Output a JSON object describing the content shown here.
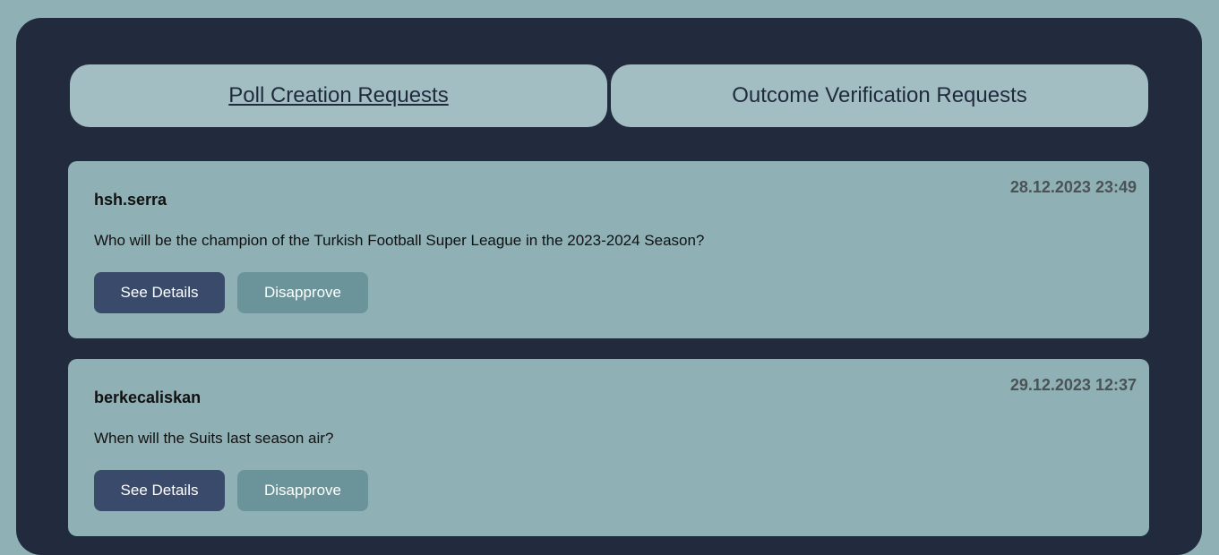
{
  "tabs": [
    {
      "label": "Poll Creation Requests",
      "active": true
    },
    {
      "label": "Outcome Verification Requests",
      "active": false
    }
  ],
  "requests": [
    {
      "user": "hsh.serra",
      "timestamp": "28.12.2023 23:49",
      "question": "Who will be the champion of the Turkish Football Super League in the 2023-2024 Season?",
      "details_label": "See Details",
      "disapprove_label": "Disapprove"
    },
    {
      "user": "berkecaliskan",
      "timestamp": "29.12.2023 12:37",
      "question": "When will the Suits last season air?",
      "details_label": "See Details",
      "disapprove_label": "Disapprove"
    }
  ],
  "colors": {
    "page_bg": "#8fb0b4",
    "panel_bg": "#222a3e",
    "tab_bg": "#a3bec2",
    "card_bg": "#8fb0b4",
    "details_button": "#3a4a6a",
    "disapprove_button": "#6a9499"
  }
}
